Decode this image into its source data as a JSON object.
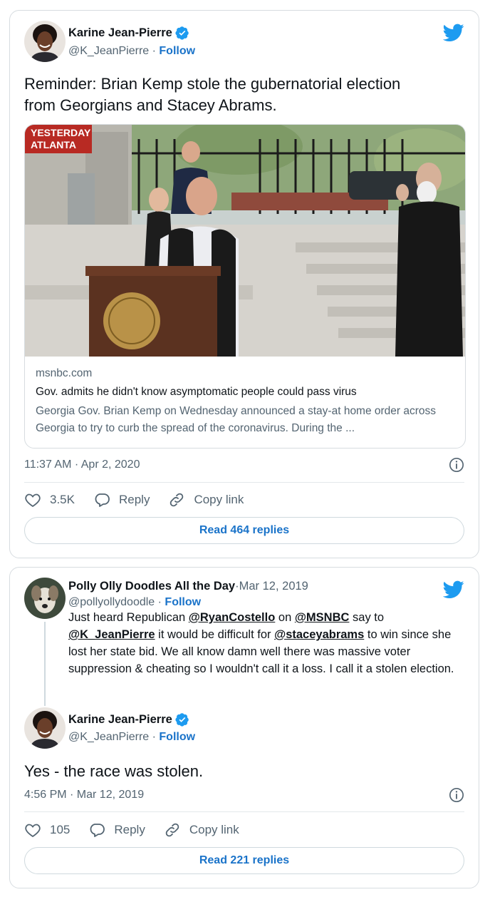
{
  "tweet1": {
    "author_name": "Karine Jean-Pierre",
    "handle": "@K_JeanPierre",
    "follow_label": "Follow",
    "separator": " · ",
    "text_line1": "Reminder: Brian Kemp stole the gubernatorial election",
    "text_line2": "from  Georgians and Stacey Abrams.",
    "media": {
      "overlay_line1": "YESTERDAY",
      "overlay_line2": "ATLANTA",
      "domain": "msnbc.com",
      "title": "Gov. admits he didn't know asymptomatic people could pass virus",
      "description": "Georgia Gov. Brian Kemp on Wednesday announced a stay-at home order across Georgia to try to curb the spread of the coronavirus. During the ..."
    },
    "timestamp": "11:37 AM · Apr 2, 2020",
    "likes": "3.5K",
    "reply_label": "Reply",
    "copy_link_label": "Copy link",
    "read_replies_label": "Read 464 replies"
  },
  "tweet2": {
    "parent": {
      "author_name": "Polly Olly Doodles All the Day",
      "date": "Mar 12, 2019",
      "handle": "@pollyollydoodle",
      "follow_label": "Follow",
      "separator": " · ",
      "text_part1": "Just heard Republican ",
      "mention1": "@RyanCostello",
      "text_part2": " on ",
      "mention2": "@MSNBC",
      "text_part3": " say to ",
      "mention3": "@K_JeanPierre",
      "text_part4": " it would be difficult for ",
      "mention4": "@staceyabrams",
      "text_part5": " to win since she lost her state bid. We all know damn well there was massive voter suppression & cheating so I wouldn't call it a loss. I call it a stolen election."
    },
    "author_name": "Karine Jean-Pierre",
    "handle": "@K_JeanPierre",
    "follow_label": "Follow",
    "separator": " · ",
    "text": "Yes - the race was stolen.",
    "timestamp": "4:56 PM · Mar 12, 2019",
    "likes": "105",
    "reply_label": "Reply",
    "copy_link_label": "Copy link",
    "read_replies_label": "Read 221 replies"
  },
  "colors": {
    "twitter_blue": "#1d9bf0",
    "link_blue": "#1a73c9",
    "secondary_text": "#536471",
    "border": "#d7dce0"
  },
  "icons": [
    "twitter-bird-icon",
    "verified-badge-icon",
    "info-icon",
    "heart-icon",
    "reply-bubble-icon",
    "link-icon"
  ]
}
